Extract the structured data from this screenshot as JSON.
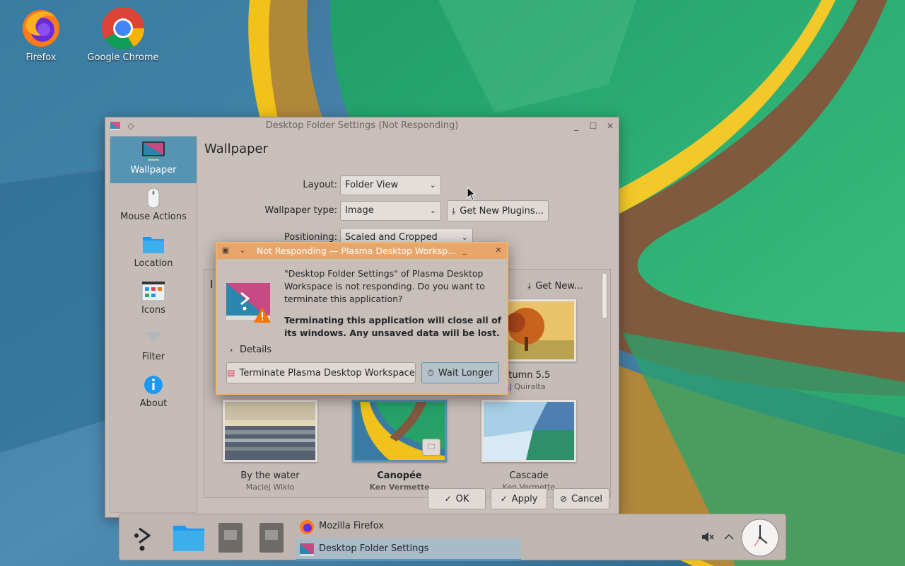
{
  "desktop": {
    "icons": [
      {
        "label": "Firefox",
        "icon": "firefox-icon"
      },
      {
        "label": "Google Chrome",
        "icon": "chrome-icon"
      }
    ]
  },
  "settings_window": {
    "title": "Desktop Folder Settings (Not Responding)",
    "sidebar": [
      {
        "label": "Wallpaper",
        "icon": "monitor-icon",
        "active": true
      },
      {
        "label": "Mouse Actions",
        "icon": "mouse-icon"
      },
      {
        "label": "Location",
        "icon": "folder-icon"
      },
      {
        "label": "Icons",
        "icon": "icons-grid-icon"
      },
      {
        "label": "Filter",
        "icon": "filter-icon"
      },
      {
        "label": "About",
        "icon": "info-icon"
      }
    ],
    "page_title": "Wallpaper",
    "layout_label": "Layout:",
    "layout_value": "Folder View",
    "wallpaper_type_label": "Wallpaper type:",
    "wallpaper_type_value": "Image",
    "get_plugins_label": "Get New Plugins...",
    "positioning_label": "Positioning:",
    "positioning_value": "Scaled and Cropped",
    "get_new_label": "Get New...",
    "partial_label": "I",
    "wallpapers": [
      {
        "name": "utumn 5.5",
        "author": "RJ Quiralta"
      },
      {
        "name": "By the water",
        "author": "Maciej Wikło"
      },
      {
        "name": "Canopée",
        "author": "Ken Vermette",
        "selected": true
      },
      {
        "name": "Cascade",
        "author": "Ken Vermette"
      }
    ],
    "ok_label": "OK",
    "apply_label": "Apply",
    "cancel_label": "Cancel"
  },
  "dialog": {
    "title": "Not Responding — Plasma Desktop Worksp...",
    "message": "\"Desktop Folder Settings\" of Plasma Desktop Workspace is not responding. Do you want to terminate this application?",
    "warning": "Terminating this application will close all of its windows. Any unsaved data will be lost.",
    "details_label": "Details",
    "terminate_label": "Terminate Plasma Desktop Workspace",
    "wait_label": "Wait Longer"
  },
  "taskbar": {
    "tasks": [
      {
        "label": "Mozilla Firefox",
        "icon": "firefox-icon"
      },
      {
        "label": "Desktop Folder Settings",
        "icon": "settings-icon",
        "active": true
      }
    ]
  },
  "colors": {
    "accent": "#5694b4",
    "dialog_title": "#e9a66b",
    "window_bg": "#c9bfba"
  }
}
